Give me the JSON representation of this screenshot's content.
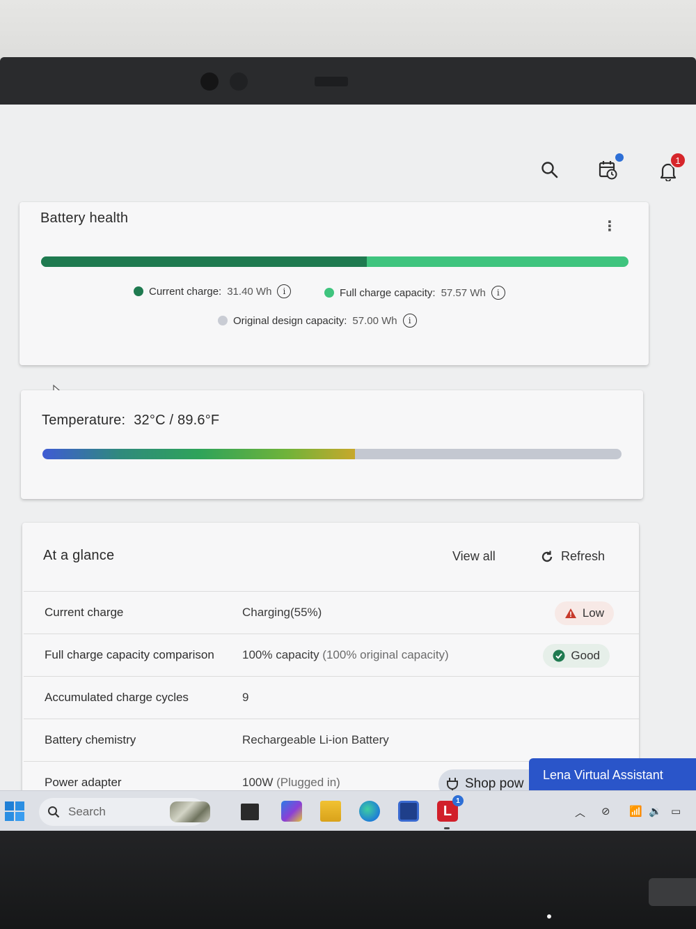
{
  "header": {
    "notification_count": "1"
  },
  "battery_health": {
    "title": "Battery health",
    "current_charge_fraction": 0.555,
    "legend": {
      "current_charge_label": "Current charge:",
      "current_charge_value": "31.40 Wh",
      "full_capacity_label": "Full charge capacity:",
      "full_capacity_value": "57.57 Wh",
      "design_capacity_label": "Original design capacity:",
      "design_capacity_value": "57.00 Wh"
    },
    "colors": {
      "current": "#1f7a50",
      "full": "#3fc47e",
      "design": "#c9ccd4"
    }
  },
  "temperature": {
    "label": "Temperature:",
    "value": "32°C / 89.6°F",
    "level_fraction": 0.54
  },
  "glance": {
    "title": "At a glance",
    "view_all": "View all",
    "refresh": "Refresh",
    "rows": [
      {
        "label": "Current charge",
        "value": "Charging(55%)",
        "muted": "",
        "status": "Low"
      },
      {
        "label": "Full charge capacity comparison",
        "value": "100% capacity ",
        "muted": "(100% original capacity)",
        "status": "Good"
      },
      {
        "label": "Accumulated charge cycles",
        "value": "9",
        "muted": "",
        "status": ""
      },
      {
        "label": "Battery chemistry",
        "value": "Rechargeable Li-ion Battery",
        "muted": "",
        "status": ""
      },
      {
        "label": "Power adapter",
        "value": "100W ",
        "muted": "(Plugged in)",
        "status": ""
      }
    ]
  },
  "shop_button": "Shop pow",
  "assistant": "Lena Virtual Assistant",
  "taskbar": {
    "search_placeholder": "Search",
    "app_badge": "1"
  }
}
